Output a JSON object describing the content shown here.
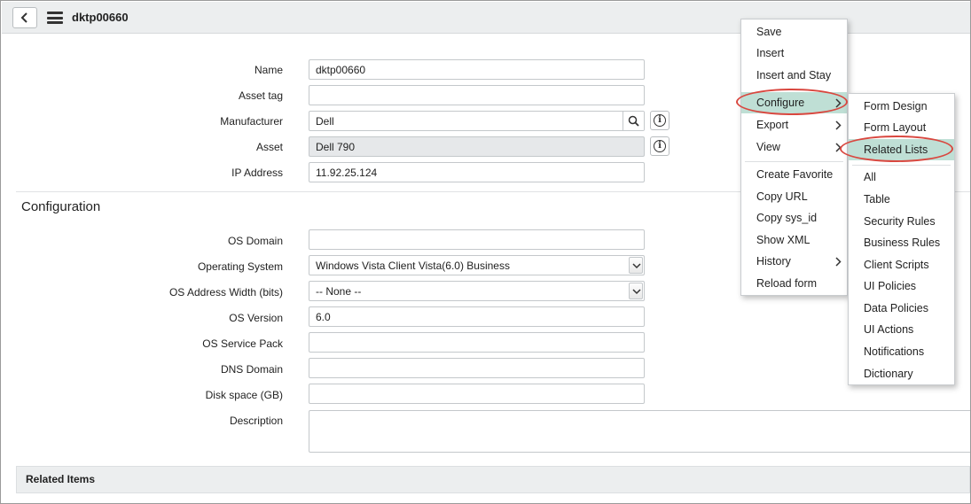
{
  "header": {
    "title": "dktp00660"
  },
  "form": {
    "name_label": "Name",
    "name_value": "dktp00660",
    "asset_tag_label": "Asset tag",
    "asset_tag_value": "",
    "manufacturer_label": "Manufacturer",
    "manufacturer_value": "Dell",
    "asset_label": "Asset",
    "asset_value": "Dell 790",
    "ip_label": "IP Address",
    "ip_value": "11.92.25.124"
  },
  "configuration": {
    "section_title": "Configuration",
    "os_domain_label": "OS Domain",
    "os_domain_value": "",
    "os_label": "Operating System",
    "os_value": "Windows Vista Client Vista(6.0) Business",
    "os_width_label": "OS Address Width (bits)",
    "os_width_value": "-- None --",
    "os_version_label": "OS Version",
    "os_version_value": "6.0",
    "os_sp_label": "OS Service Pack",
    "os_sp_value": "",
    "dns_label": "DNS Domain",
    "dns_value": "",
    "disk_label": "Disk space (GB)",
    "disk_value": "",
    "description_label": "Description",
    "description_value": ""
  },
  "related": {
    "label": "Related Items"
  },
  "context_menu": {
    "items": [
      "Save",
      "Insert",
      "Insert and Stay",
      "Configure",
      "Export",
      "View",
      "Create Favorite",
      "Copy URL",
      "Copy sys_id",
      "Show XML",
      "History",
      "Reload form"
    ]
  },
  "configure_submenu": {
    "items": [
      "Form Design",
      "Form Layout",
      "Related Lists",
      "All",
      "Table",
      "Security Rules",
      "Business Rules",
      "Client Scripts",
      "UI Policies",
      "Data Policies",
      "UI Actions",
      "Notifications",
      "Dictionary"
    ]
  },
  "icons": {
    "back": "chevron-left-icon",
    "menu": "hamburger-icon",
    "search": "search-icon",
    "info": "info-icon",
    "submenu": "chevron-right-icon",
    "dropdown": "chevron-down-icon"
  },
  "colors": {
    "highlight": "#bfdfd5",
    "annotation": "#d9473f",
    "header_bg": "#eceeef"
  }
}
